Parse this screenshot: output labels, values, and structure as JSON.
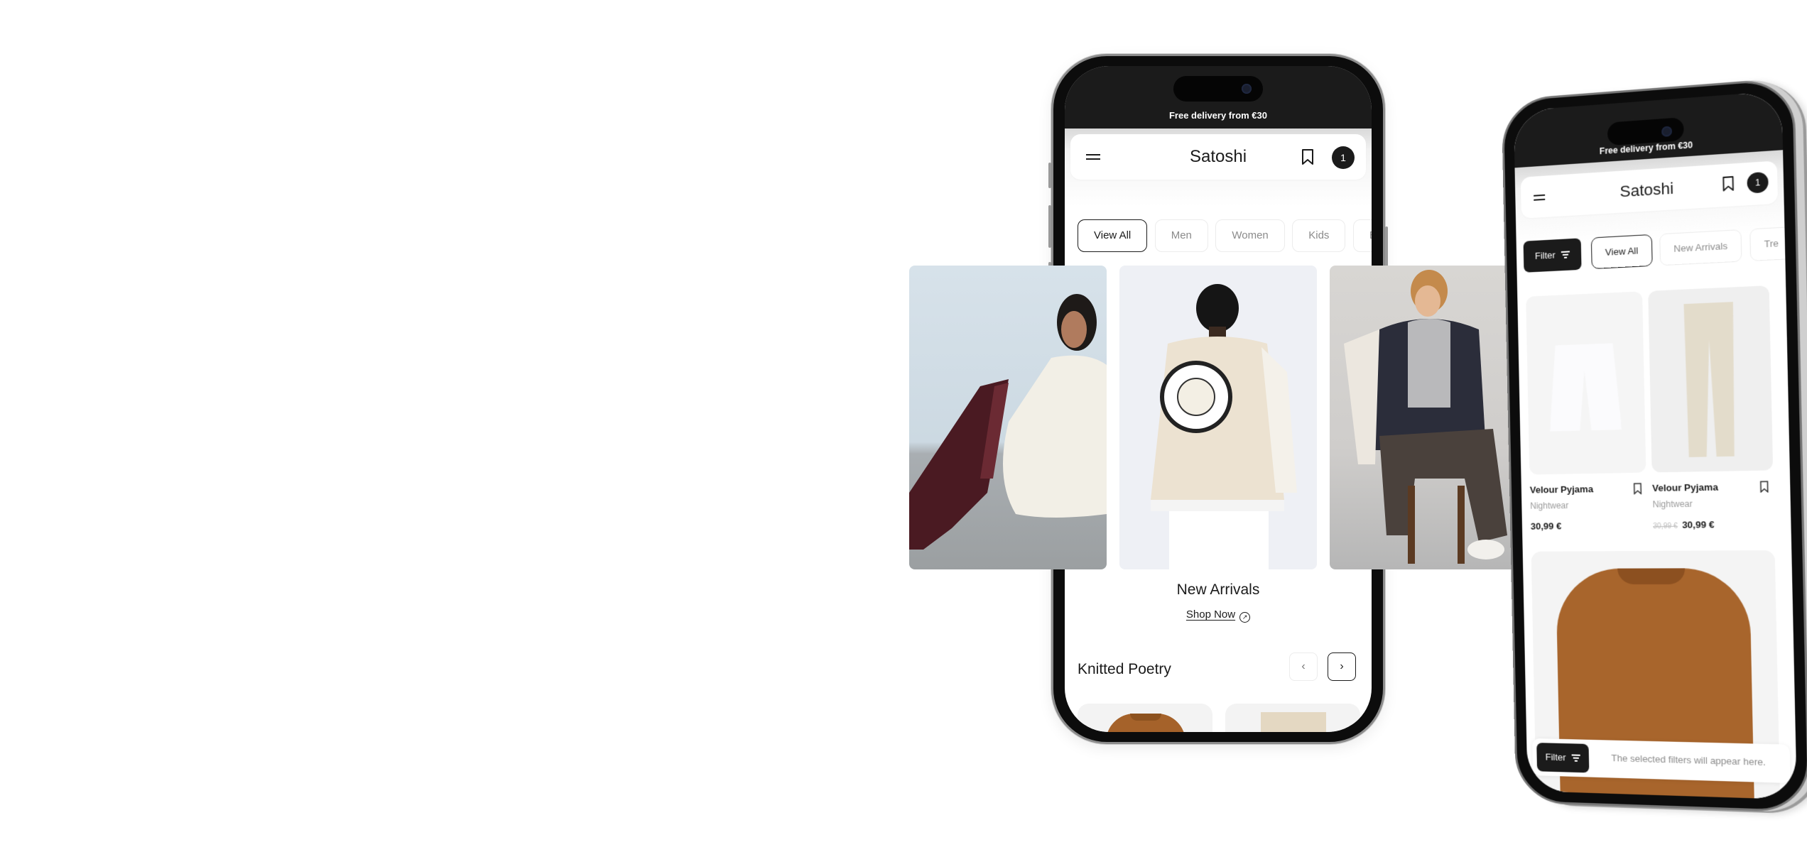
{
  "phone_home": {
    "promo_banner": "Free delivery from €30",
    "header": {
      "brand": "Satoshi",
      "menu_icon": "hamburger-icon",
      "wishlist_icon": "bookmark-icon",
      "cart_count": "1"
    },
    "category_chips": [
      {
        "label": "View All",
        "active": true
      },
      {
        "label": "Men",
        "active": false
      },
      {
        "label": "Women",
        "active": false
      },
      {
        "label": "Kids",
        "active": false
      },
      {
        "label": "Be",
        "active": false
      }
    ],
    "hero": {
      "images": [
        "woman-in-white-dress-burgundy-boots",
        "man-in-varsity-jacket-back-view",
        "man-in-varsity-jacket-on-chair"
      ],
      "title": "New Arrivals",
      "cta_label": "Shop Now",
      "cta_icon": "arrow-up-right-circle-icon"
    },
    "section": {
      "title": "Knitted Poetry",
      "prev_icon": "chevron-left-icon",
      "next_icon": "chevron-right-icon",
      "products": [
        "brown-knit-sweater",
        "beige-knit-skirt"
      ]
    }
  },
  "phone_catalog": {
    "promo_banner": "Free delivery from €30",
    "header": {
      "brand": "Satoshi",
      "cart_count": "1"
    },
    "filter_label": "Filter",
    "chips": [
      {
        "label": "View All",
        "active": true
      },
      {
        "label": "New Arrivals",
        "active": false
      },
      {
        "label": "Tre",
        "active": false
      }
    ],
    "products": [
      {
        "name": "Velour Pyjama",
        "category": "Nightwear",
        "price": "30,99 €",
        "old_price": null,
        "image": "white-shorts"
      },
      {
        "name": "Velour Pyjama",
        "category": "Nightwear",
        "price": "30,99 €",
        "old_price": "30,99 €",
        "image": "beige-trousers"
      }
    ],
    "featured_image": "brown-knit-sweater",
    "filter_bar": {
      "button_label": "Filter",
      "hint": "The selected filters will appear here."
    }
  }
}
